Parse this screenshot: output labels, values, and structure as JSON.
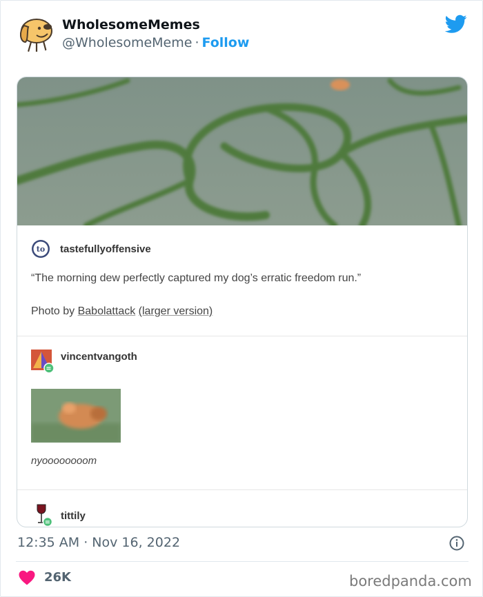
{
  "header": {
    "display_name": "WholesomeMemes",
    "handle": "@WholesomeMeme",
    "separator": "·",
    "follow_label": "Follow"
  },
  "card": {
    "post1": {
      "username": "tastefullyoffensive",
      "icon_text": "to",
      "quote": "“The morning dew perfectly captured my dog’s erratic freedom run.”",
      "credit_prefix": "Photo by ",
      "credit_user": "Babolattack",
      "credit_link": "(larger version)"
    },
    "post2": {
      "username": "vincentvangoth",
      "caption": "nyoooooooom"
    },
    "post3": {
      "username": "tittily"
    }
  },
  "footer": {
    "timestamp": "12:35 AM · Nov 16, 2022",
    "likes": "26K",
    "watermark": "boredpanda.com"
  },
  "colors": {
    "twitter_blue": "#1d9bf0",
    "heart_red": "#f91880",
    "muted_text": "#536471"
  },
  "icons": [
    "dog-avatar-icon",
    "twitter-bird-icon",
    "info-icon",
    "heart-icon",
    "reblog-badge-icon"
  ]
}
